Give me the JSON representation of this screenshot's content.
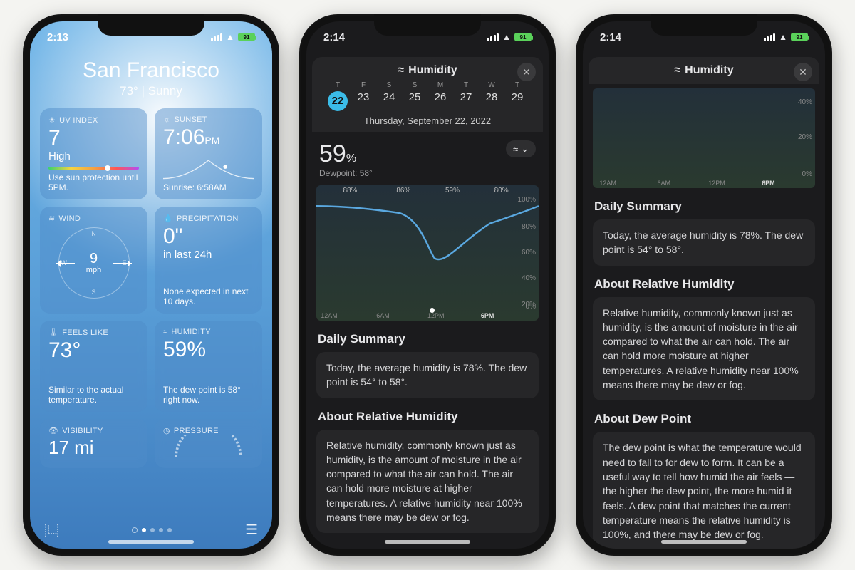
{
  "phone1": {
    "status_time": "2:13",
    "battery": "91",
    "location": "San Francisco",
    "summary": "73°  |  Sunny",
    "tiles": {
      "uv": {
        "hdr": "UV INDEX",
        "val": "7",
        "sub": "High",
        "foot": "Use sun protection until 5PM."
      },
      "sunset": {
        "hdr": "SUNSET",
        "val": "7:06",
        "ampm": "PM",
        "foot": "Sunrise: 6:58AM"
      },
      "wind": {
        "hdr": "WIND",
        "val": "9",
        "unit": "mph"
      },
      "precip": {
        "hdr": "PRECIPITATION",
        "val": "0\"",
        "sub": "in last 24h",
        "foot": "None expected in next 10 days."
      },
      "feels": {
        "hdr": "FEELS LIKE",
        "val": "73°",
        "foot": "Similar to the actual temperature."
      },
      "humid": {
        "hdr": "HUMIDITY",
        "val": "59%",
        "foot": "The dew point is 58° right now."
      },
      "vis": {
        "hdr": "VISIBILITY",
        "val": "17 mi"
      },
      "press": {
        "hdr": "PRESSURE"
      }
    }
  },
  "phone2": {
    "status_time": "2:14",
    "battery": "91",
    "title": "Humidity",
    "days": [
      {
        "d": "T",
        "n": "22",
        "sel": true
      },
      {
        "d": "F",
        "n": "23"
      },
      {
        "d": "S",
        "n": "24"
      },
      {
        "d": "S",
        "n": "25"
      },
      {
        "d": "M",
        "n": "26"
      },
      {
        "d": "T",
        "n": "27"
      },
      {
        "d": "W",
        "n": "28"
      },
      {
        "d": "T",
        "n": "29"
      }
    ],
    "date_full": "Thursday, September 22, 2022",
    "current": "59",
    "current_unit": "%",
    "dewpoint_lbl": "Dewpoint: 58°",
    "seg_labels": [
      "88%",
      "86%",
      "59%",
      "80%"
    ],
    "summary_h": "Daily Summary",
    "summary_txt": "Today, the average humidity is 78%. The dew point is 54° to 58°.",
    "about_h": "About Relative Humidity",
    "about_txt": "Relative humidity, commonly known just as humidity, is the amount of moisture in the air compared to what the air can hold. The air can hold more moisture at higher temperatures. A relative humidity near 100% means there may be dew or fog."
  },
  "phone3": {
    "status_time": "2:14",
    "battery": "91",
    "title": "Humidity",
    "summary_h": "Daily Summary",
    "summary_txt": "Today, the average humidity is 78%. The dew point is 54° to 58°.",
    "about1_h": "About Relative Humidity",
    "about1_txt": "Relative humidity, commonly known just as humidity, is the amount of moisture in the air compared to what the air can hold. The air can hold more moisture at higher temperatures. A relative humidity near 100% means there may be dew or fog.",
    "about2_h": "About Dew Point",
    "about2_txt": "The dew point is what the temperature would need to fall to for dew to form. It can be a useful way to tell how humid the air feels — the higher the dew point, the more humid it feels. A dew point that matches the current temperature means the relative humidity is 100%, and there may be dew or fog."
  },
  "chart_data": {
    "type": "line",
    "title": "Humidity — Thursday, September 22, 2022",
    "xlabel": "",
    "ylabel": "Humidity (%)",
    "ylim": [
      0,
      100
    ],
    "x": [
      "12AM",
      "6AM",
      "12PM",
      "6PM",
      "12AM"
    ],
    "values": [
      88,
      86,
      59,
      80,
      88
    ],
    "segment_averages": {
      "12AM-6AM": 88,
      "6AM-12PM": 86,
      "12PM-6PM": 59,
      "6PM-12AM": 80
    },
    "now_marker_x": "2PM",
    "now_value": 59
  },
  "mini_chart_data": {
    "type": "line",
    "ylim": [
      0,
      40
    ],
    "y_ticks": [
      "40%",
      "20%",
      "0%"
    ],
    "x_ticks": [
      "12AM",
      "6AM",
      "12PM",
      "6PM"
    ]
  }
}
